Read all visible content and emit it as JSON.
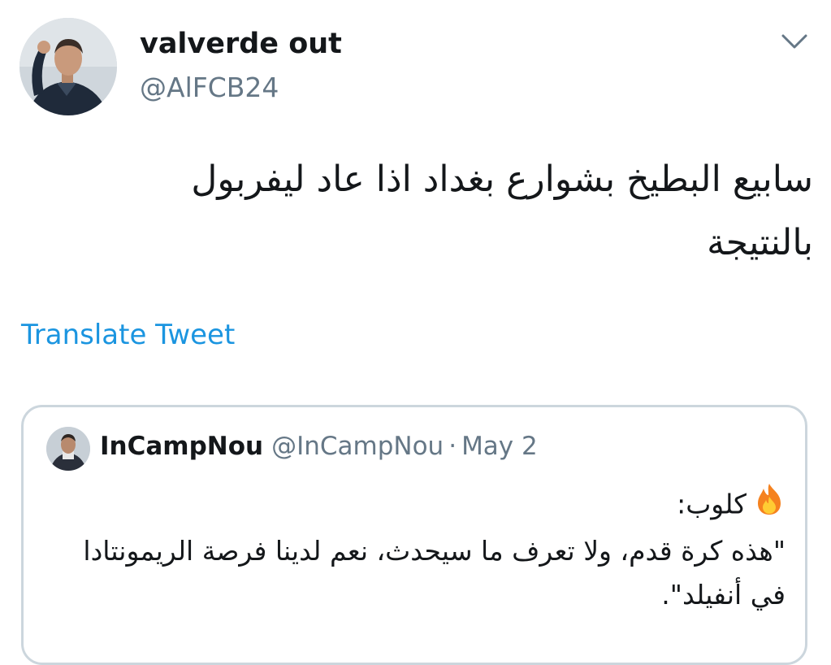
{
  "tweet": {
    "display_name": "valverde out",
    "handle": "@AlFCB24",
    "text_line1": "سابيع البطيخ بشوارع بغداد اذا عاد ليفربول",
    "text_line2": "بالنتيجة",
    "translate_label": "Translate Tweet",
    "menu_icon": "chevron-down-icon"
  },
  "quoted_tweet": {
    "display_name": "InCampNou",
    "handle": "@InCampNou",
    "separator": "·",
    "date": "May 2",
    "line1_text": "كلوب:",
    "line1_emoji": "fire-icon",
    "line2": "\"هذه كرة قدم، ولا تعرف ما سيحدث، نعم لدينا فرصة الريمونتادا",
    "line3": "في أنفيلد\"."
  },
  "colors": {
    "link": "#1b95e0",
    "secondary_text": "#657786",
    "primary_text": "#14171a",
    "border": "#ccd6dd"
  }
}
